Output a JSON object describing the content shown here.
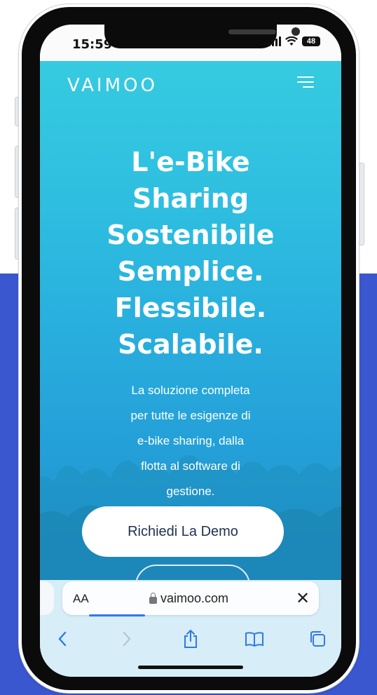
{
  "status_bar": {
    "time": "15:59",
    "battery": "48"
  },
  "header": {
    "logo": "VAIMOO",
    "menu_icon": "hamburger-menu-icon"
  },
  "hero": {
    "headline": [
      "L'e-Bike",
      "Sharing",
      "Sostenibile",
      "Semplice.",
      "Flessibile.",
      "Scalabile."
    ],
    "subtitle": [
      "La soluzione completa",
      "per tutte le esigenze di",
      "e-bike sharing, dalla",
      "flotta al software di",
      "gestione."
    ],
    "cta_label": "Richiedi La Demo"
  },
  "browser": {
    "text_size_label": "AA",
    "url": "vaimoo.com",
    "toolbar_icons": [
      "back-icon",
      "forward-icon",
      "share-icon",
      "bookmarks-icon",
      "tabs-icon"
    ]
  },
  "colors": {
    "page_accent": "#3b57cf",
    "hero_top": "#36cbe0",
    "hero_bottom": "#1f8fd0",
    "cta_text": "#1f3050"
  }
}
